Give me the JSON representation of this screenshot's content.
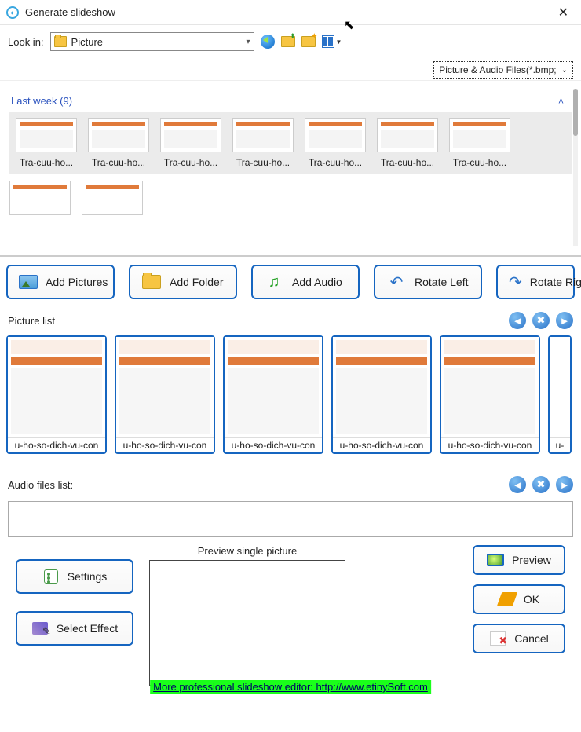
{
  "window": {
    "title": "Generate slideshow"
  },
  "lookbar": {
    "label": "Look in:",
    "folder": "Picture",
    "filetype": "Picture & Audio Files(*.bmp;"
  },
  "browser": {
    "group_label": "Last week (9)",
    "thumbs": [
      "Tra-cuu-ho...",
      "Tra-cuu-ho...",
      "Tra-cuu-ho...",
      "Tra-cuu-ho...",
      "Tra-cuu-ho...",
      "Tra-cuu-ho...",
      "Tra-cuu-ho..."
    ]
  },
  "bigbuttons": {
    "add_pictures": "Add Pictures",
    "add_folder": "Add Folder",
    "add_audio": "Add Audio",
    "rotate_left": "Rotate Left",
    "rotate_right": "Rotate Right"
  },
  "sections": {
    "picture_list": "Picture list",
    "audio_list": "Audio files list:"
  },
  "piclist": [
    "u-ho-so-dich-vu-con",
    "u-ho-so-dich-vu-con",
    "u-ho-so-dich-vu-con",
    "u-ho-so-dich-vu-con",
    "u-ho-so-dich-vu-con",
    "u-"
  ],
  "preview": {
    "label": "Preview single picture"
  },
  "side": {
    "settings": "Settings",
    "select_effect": "Select Effect",
    "preview": "Preview",
    "ok": "OK",
    "cancel": "Cancel"
  },
  "footer": "More professional slideshow editor: http://www.etinySoft.com"
}
